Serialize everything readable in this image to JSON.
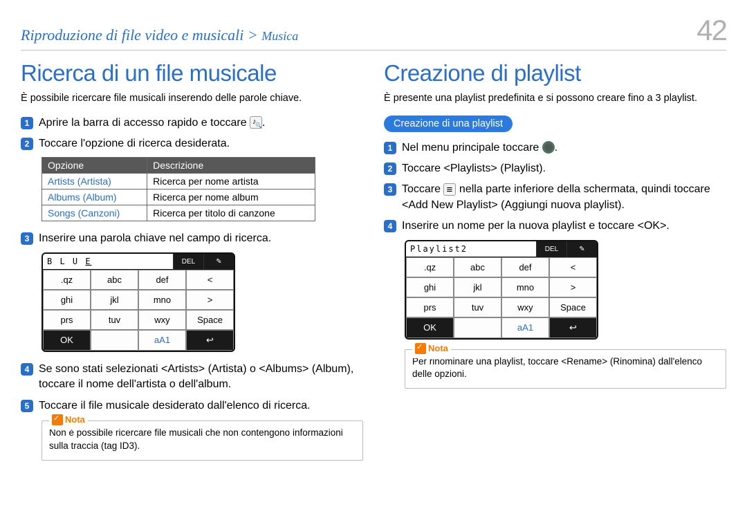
{
  "header": {
    "breadcrumb_main": "Riproduzione di file video e musicali > ",
    "breadcrumb_sub": "Musica",
    "page_number": "42"
  },
  "left": {
    "title": "Ricerca di un file musicale",
    "lead": "È possibile ricercare file musicali inserendo delle parole chiave.",
    "step1": "Aprire la barra di accesso rapido e toccare ",
    "step1_end": ".",
    "step2": "Toccare l'opzione di ricerca desiderata.",
    "table": {
      "h1": "Opzione",
      "h2": "Descrizione",
      "r1c1": "Artists (Artista)",
      "r1c2": "Ricerca per nome artista",
      "r2c1": "Albums (Album)",
      "r2c2": "Ricerca per nome album",
      "r3c1": "Songs (Canzoni)",
      "r3c2": "Ricerca per titolo di canzone"
    },
    "step3": "Inserire una parola chiave nel campo di ricerca.",
    "kbd": {
      "display_prefix": "B L U ",
      "display_cursor": "E",
      "del": "DEL",
      "pencil": "✎",
      "k_qz": ".qz",
      "k_abc": "abc",
      "k_def": "def",
      "k_lt": "<",
      "k_ghi": "ghi",
      "k_jkl": "jkl",
      "k_mno": "mno",
      "k_gt": ">",
      "k_prs": "prs",
      "k_tuv": "tuv",
      "k_wxy": "wxy",
      "k_space": "Space",
      "k_ok": "OK",
      "k_aA1": "aA1",
      "k_enter": "↩"
    },
    "step4": "Se sono stati selezionati <Artists> (Artista) o <Albums> (Album), toccare il nome dell'artista o dell'album.",
    "step5": "Toccare il file musicale desiderato dall'elenco di ricerca.",
    "note_label": "Nota",
    "note_text": "Non è possibile ricercare file musicali che non contengono informazioni sulla traccia (tag ID3)."
  },
  "right": {
    "title": "Creazione di playlist",
    "lead": "È presente una playlist predefinita e si possono creare fino a 3 playlist.",
    "pill": "Creazione di una playlist",
    "step1": "Nel menu principale toccare ",
    "step1_end": ".",
    "step2": "Toccare <Playlists> (Playlist).",
    "step3a": "Toccare ",
    "step3b": " nella parte inferiore della schermata, quindi toccare <Add New Playlist> (Aggiungi nuova playlist).",
    "step4": "Inserire un nome per la nuova playlist e toccare <OK>.",
    "kbd": {
      "display": "Playlist2",
      "del": "DEL",
      "pencil": "✎",
      "k_qz": ".qz",
      "k_abc": "abc",
      "k_def": "def",
      "k_lt": "<",
      "k_ghi": "ghi",
      "k_jkl": "jkl",
      "k_mno": "mno",
      "k_gt": ">",
      "k_prs": "prs",
      "k_tuv": "tuv",
      "k_wxy": "wxy",
      "k_space": "Space",
      "k_ok": "OK",
      "k_aA1": "aA1",
      "k_enter": "↩"
    },
    "note_label": "Nota",
    "note_text": "Per rinominare una playlist, toccare <Rename> (Rinomina) dall'elenco delle opzioni."
  }
}
